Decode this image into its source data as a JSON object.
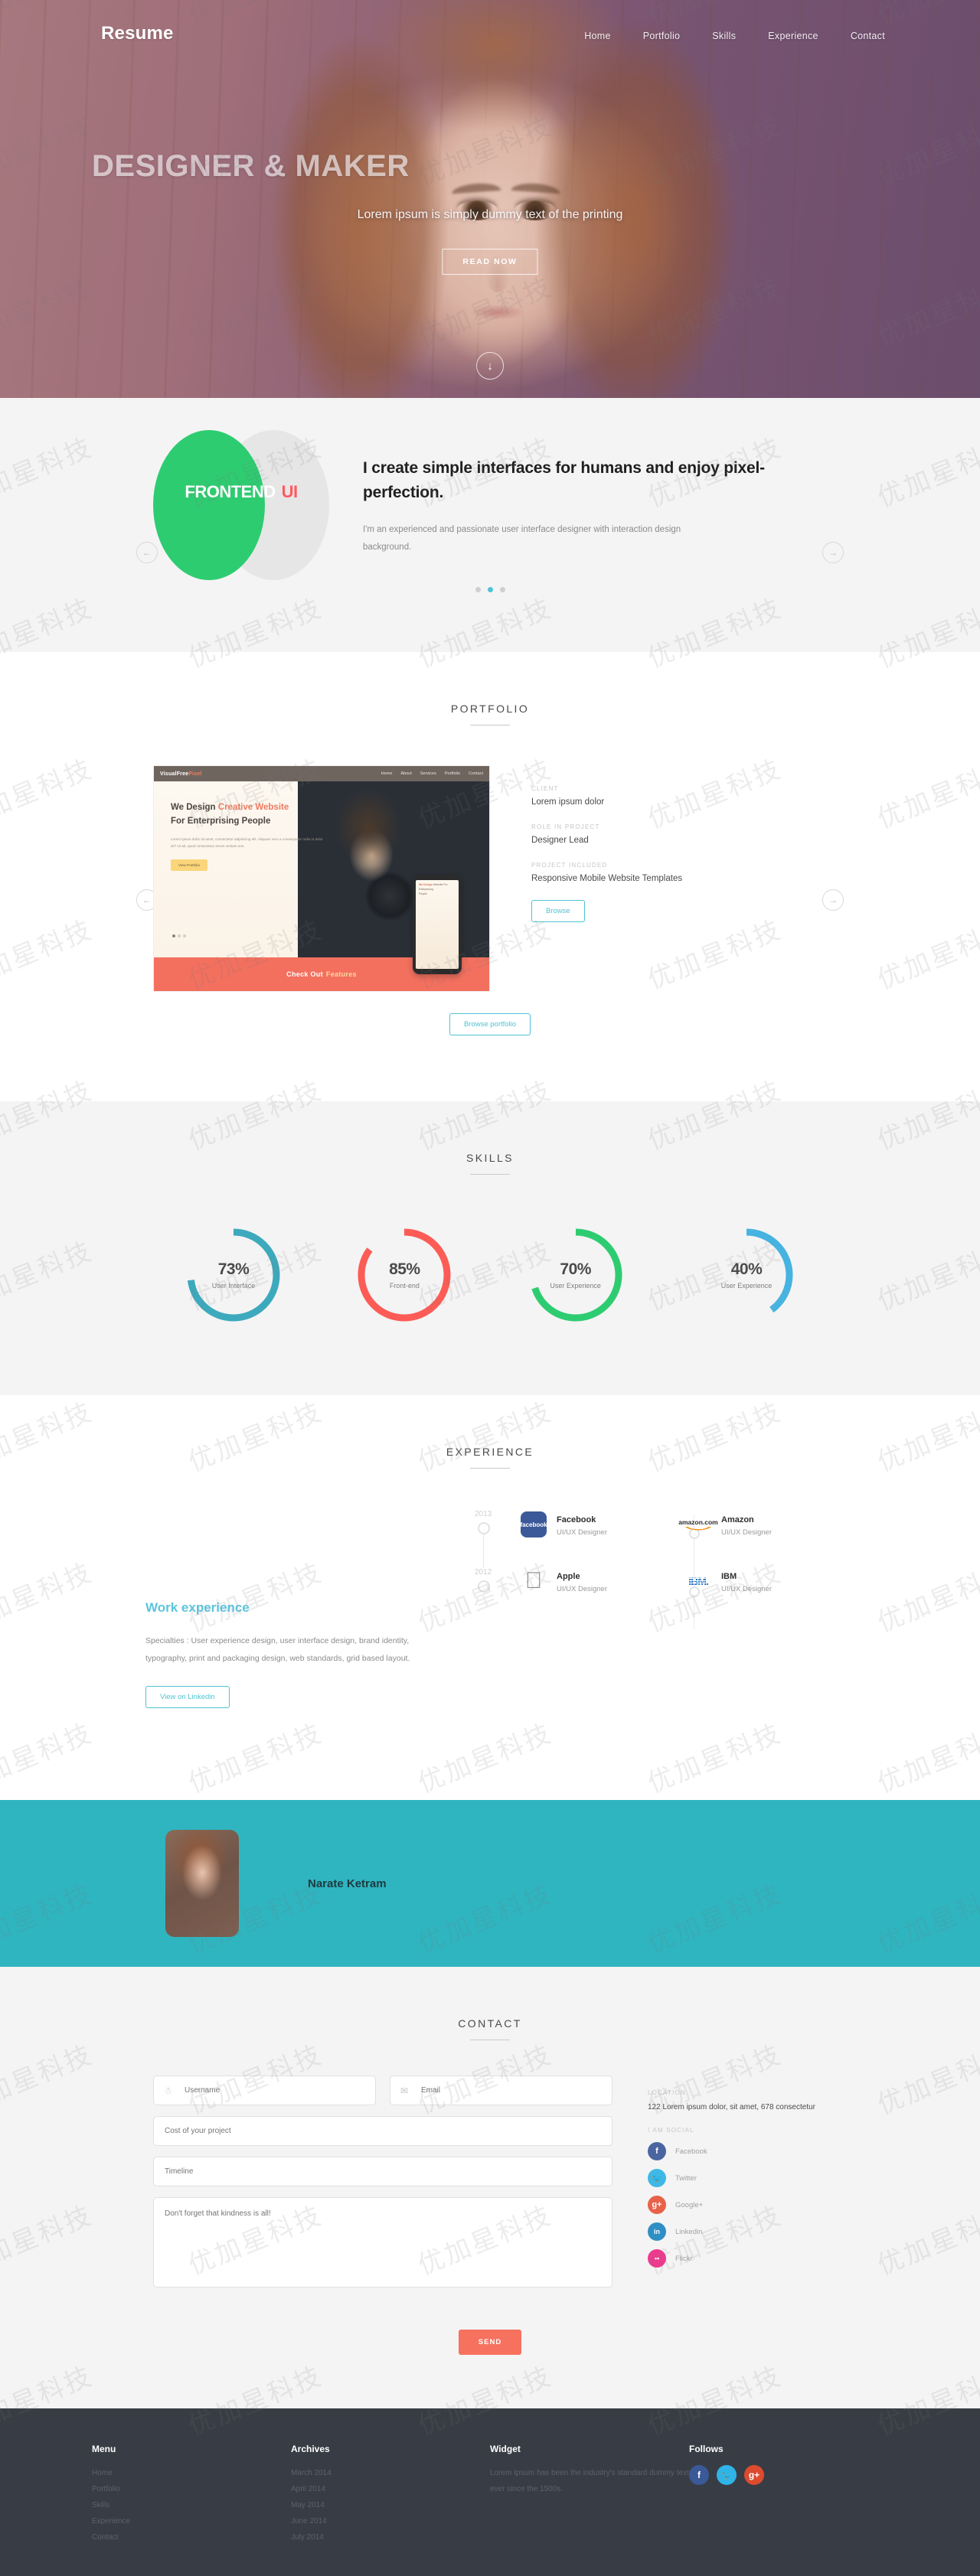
{
  "brand": "Resume",
  "nav": [
    {
      "label": "Home"
    },
    {
      "label": "Portfolio"
    },
    {
      "label": "Skills"
    },
    {
      "label": "Experience"
    },
    {
      "label": "Contact"
    }
  ],
  "hero": {
    "title": "DESIGNER & MAKER",
    "subtitle": "Lorem ipsum is simply dummy text of the printing",
    "button": "READ NOW",
    "scroll_icon": "arrow-down-icon"
  },
  "about": {
    "venn_left": "FRONTEND",
    "venn_right": "UI",
    "heading": "I create simple interfaces for humans and enjoy pixel-perfection.",
    "body": "I'm an experienced and passionate user interface designer with interaction design background.",
    "dots": 3,
    "active_dot": 2,
    "prev_icon": "arrow-left-icon",
    "next_icon": "arrow-right-icon"
  },
  "portfolio": {
    "title": "PORTFOLIO",
    "shot": {
      "logo": "VisualFree",
      "logo_accent": "Pixel",
      "menu": [
        "Home",
        "About",
        "Services",
        "Portfolio",
        "Contact"
      ],
      "headline_1": "We Design ",
      "headline_accent": "Creative Website",
      "headline_2": "For Enterprising People",
      "paragraph": "Lorem ipsum dolor sit amet, consectetur adipisicing elit. Aliquam vero a consequatur nulla ut dolor sit? Ut ab, quod consectetur rerum veniam eos.",
      "cta": "View Portfolio",
      "footer_text": "Check Out",
      "footer_accent": "Features",
      "phone_line1": "We Design",
      "phone_line2": "Website For",
      "phone_line3": "Enterprising",
      "phone_line4": "People"
    },
    "meta": [
      {
        "key": "CLIENT",
        "value": "Lorem ipsum dolor"
      },
      {
        "key": "ROLE IN PROJECT",
        "value": "Designer Lead"
      },
      {
        "key": "PROJECT INCLUDED",
        "value": "Responsive Mobile Website Templates"
      }
    ],
    "browse_button": "Browse",
    "browse_all_button": "Browse portfolio",
    "prev_icon": "arrow-left-icon",
    "next_icon": "arrow-right-icon"
  },
  "skills": {
    "title": "SKILLS",
    "items": [
      {
        "percent": 73,
        "label": "73%",
        "name": "User Interface",
        "color": "#3da9bd"
      },
      {
        "percent": 85,
        "label": "85%",
        "name": "Front-end",
        "color": "#fc5c55"
      },
      {
        "percent": 70,
        "label": "70%",
        "name": "User Experience",
        "color": "#2ecc71"
      },
      {
        "percent": 40,
        "label": "40%",
        "name": "User Experience",
        "color": "#47b3e0"
      }
    ]
  },
  "experience": {
    "title": "EXPERIENCE",
    "heading": "Work experience",
    "body": "Specialties : User experience design, user interface design, brand identity, typography, print and packaging design, web standards, grid based layout.",
    "button": "View on Linkedin",
    "years": [
      "2013",
      "2012"
    ],
    "jobs": [
      {
        "company": "Facebook",
        "role": "UI/UX Designer",
        "logo": "facebook-logo"
      },
      {
        "company": "Amazon",
        "role": "UI/UX Designer",
        "logo": "amazon-logo"
      },
      {
        "company": "Apple",
        "role": "UI/UX Designer",
        "logo": "apple-logo"
      },
      {
        "company": "IBM",
        "role": "UI/UX Designer",
        "logo": "ibm-logo"
      }
    ]
  },
  "testimonial": {
    "name": "Narate Ketram",
    "avatar": "portrait-photo"
  },
  "contact": {
    "title": "CONTACT",
    "fields": {
      "username": {
        "placeholder": "Username",
        "icon": "user-icon"
      },
      "email": {
        "placeholder": "Email",
        "icon": "envelope-icon"
      },
      "cost": {
        "placeholder": "Cost of your project"
      },
      "timeline": {
        "placeholder": "Timeline"
      },
      "message": {
        "placeholder": "Don't forget that kindness is all!"
      }
    },
    "send_button": "SEND",
    "location_key": "LOCATION",
    "location_value": "122 Lorem ipsum dolor, sit amet, 678 consectetur",
    "social_key": "I AM SOCIAL",
    "social": [
      {
        "name": "Facebook",
        "glyph": "f",
        "color": "#4a66a0"
      },
      {
        "name": "Twitter",
        "glyph": "t",
        "color": "#3fb8e5"
      },
      {
        "name": "Google+",
        "glyph": "g",
        "color": "#e8614a"
      },
      {
        "name": "Linkedin",
        "glyph": "in",
        "color": "#2f8fc4"
      },
      {
        "name": "Flickr",
        "glyph": "••",
        "color": "#ef3a8f"
      }
    ]
  },
  "footer": {
    "columns": [
      {
        "title": "Menu",
        "items": [
          "Home",
          "Portfolio",
          "Skills",
          "Experience",
          "Contact"
        ]
      },
      {
        "title": "Archives",
        "items": [
          "March 2014",
          "April 2014",
          "May 2014",
          "June 2014",
          "July 2014"
        ]
      }
    ],
    "widget": {
      "title": "Widget",
      "text": "Lorem Ipsum has been the industry's standard dummy text ever since the 1500s."
    },
    "follows": {
      "title": "Follows",
      "social": [
        {
          "name": "Facebook",
          "glyph": "f",
          "color": "#3b5998"
        },
        {
          "name": "Twitter",
          "glyph": "t",
          "color": "#2fb4e8"
        },
        {
          "name": "Google+",
          "glyph": "g",
          "color": "#dd4b2e"
        }
      ]
    }
  },
  "watermark": "优加星科技"
}
